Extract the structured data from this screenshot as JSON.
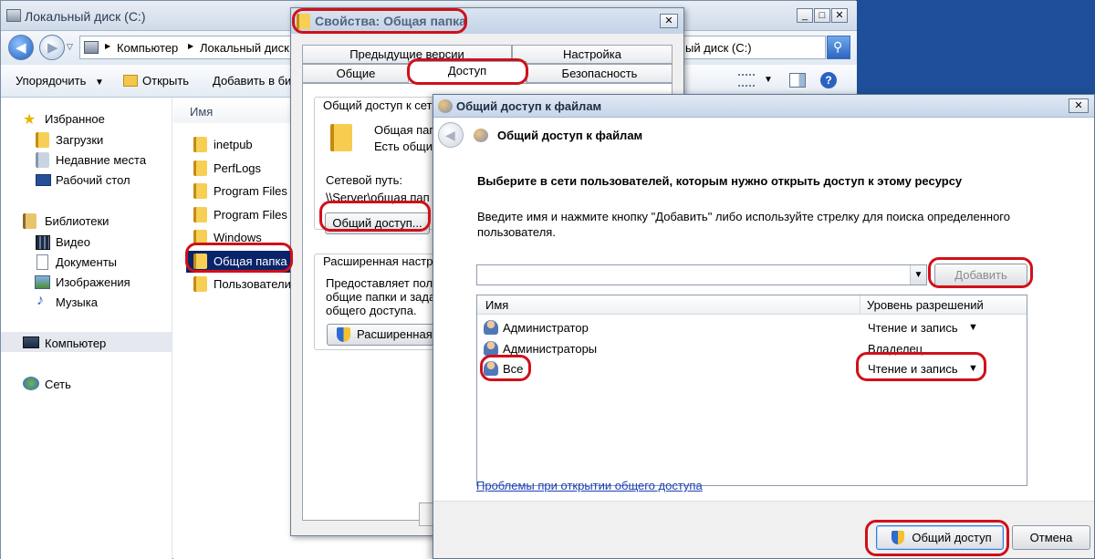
{
  "explorer": {
    "window_title": "Локальный диск (C:)",
    "address": {
      "segments": [
        "Компьютер",
        "Локальный диск"
      ],
      "right_fragment": "ый диск (C:)"
    },
    "toolbar": {
      "organize": "Упорядочить",
      "open": "Открыть",
      "add_to_library": "Добавить в би"
    },
    "nav": {
      "favorites": "Избранное",
      "downloads": "Загрузки",
      "recent": "Недавние места",
      "desktop": "Рабочий стол",
      "libraries": "Библиотеки",
      "video": "Видео",
      "documents": "Документы",
      "pictures": "Изображения",
      "music": "Музыка",
      "computer": "Компьютер",
      "network": "Сеть"
    },
    "list": {
      "column_name": "Имя",
      "items": [
        "inetpub",
        "PerfLogs",
        "Program Files",
        "Program Files (:",
        "Windows",
        "Общая папка",
        "Пользователи"
      ],
      "selected_index": 5
    }
  },
  "properties": {
    "title": "Свойства: Общая папка",
    "tabs_row1": [
      "Предыдущие версии",
      "Настройка"
    ],
    "tabs_row2": [
      "Общие",
      "Доступ",
      "Безопасность"
    ],
    "active_tab": "Доступ",
    "group1_label": "Общий доступ к сет",
    "folder_name": "Общая папк",
    "folder_status": "Есть общи",
    "network_path_label": "Сетевой путь:",
    "network_path": "\\\\Server\\общая пап",
    "share_button": "Общий доступ...",
    "group2_label": "Расширенная настр",
    "group2_desc": [
      "Предоставляет пол",
      "общие папки и зада",
      "общего доступа."
    ],
    "advanced_button": "Расширенная"
  },
  "share": {
    "window_title": "Общий доступ к файлам",
    "header": "Общий доступ к файлам",
    "instruction": "Выберите в сети пользователей, которым нужно открыть доступ к этому ресурсу",
    "hint_line1": "Введите имя и нажмите кнопку \"Добавить\" либо используйте стрелку для поиска определенного",
    "hint_line2": "пользователя.",
    "input_value": "",
    "add_button": "Добавить",
    "col_name": "Имя",
    "col_level": "Уровень разрешений",
    "rows": [
      {
        "name": "Администратор",
        "level": "Чтение и запись",
        "has_dropdown": true
      },
      {
        "name": "Администраторы",
        "level": "Владелец",
        "has_dropdown": false
      },
      {
        "name": "Все",
        "level": "Чтение и запись",
        "has_dropdown": true
      }
    ],
    "help_link": "Проблемы при открытии общего доступа",
    "share_button": "Общий доступ",
    "cancel_button": "Отмена"
  },
  "colors": {
    "highlight": "#d0101a",
    "selection": "#0a246a",
    "link": "#1a3fb8"
  }
}
